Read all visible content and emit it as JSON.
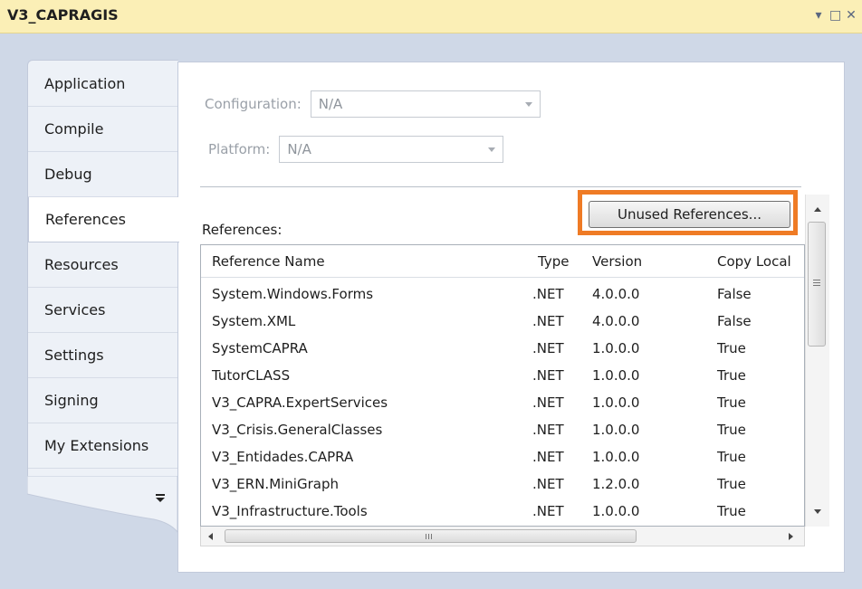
{
  "window": {
    "title": "V3_CAPRAGIS",
    "controls": {
      "dropdown": "▾",
      "maximize": "□",
      "close": "✕"
    }
  },
  "tabs": [
    {
      "label": "Application",
      "active": false
    },
    {
      "label": "Compile",
      "active": false
    },
    {
      "label": "Debug",
      "active": false
    },
    {
      "label": "References",
      "active": true
    },
    {
      "label": "Resources",
      "active": false
    },
    {
      "label": "Services",
      "active": false
    },
    {
      "label": "Settings",
      "active": false
    },
    {
      "label": "Signing",
      "active": false
    },
    {
      "label": "My Extensions",
      "active": false
    }
  ],
  "config": {
    "configuration_label": "Configuration:",
    "configuration_value": "N/A",
    "platform_label": "Platform:",
    "platform_value": "N/A"
  },
  "references": {
    "label": "References:",
    "unused_button": "Unused References...",
    "highlight_color": "#ef7b25",
    "columns": [
      "Reference Name",
      "Type",
      "Version",
      "Copy Local"
    ],
    "rows": [
      [
        "System.Windows.Forms",
        ".NET",
        "4.0.0.0",
        "False"
      ],
      [
        "System.XML",
        ".NET",
        "4.0.0.0",
        "False"
      ],
      [
        "SystemCAPRA",
        ".NET",
        "1.0.0.0",
        "True"
      ],
      [
        "TutorCLASS",
        ".NET",
        "1.0.0.0",
        "True"
      ],
      [
        "V3_CAPRA.ExpertServices",
        ".NET",
        "1.0.0.0",
        "True"
      ],
      [
        "V3_Crisis.GeneralClasses",
        ".NET",
        "1.0.0.0",
        "True"
      ],
      [
        "V3_Entidades.CAPRA",
        ".NET",
        "1.0.0.0",
        "True"
      ],
      [
        "V3_ERN.MiniGraph",
        ".NET",
        "1.2.0.0",
        "True"
      ],
      [
        "V3_Infrastructure.Tools",
        ".NET",
        "1.0.0.0",
        "True"
      ]
    ]
  }
}
